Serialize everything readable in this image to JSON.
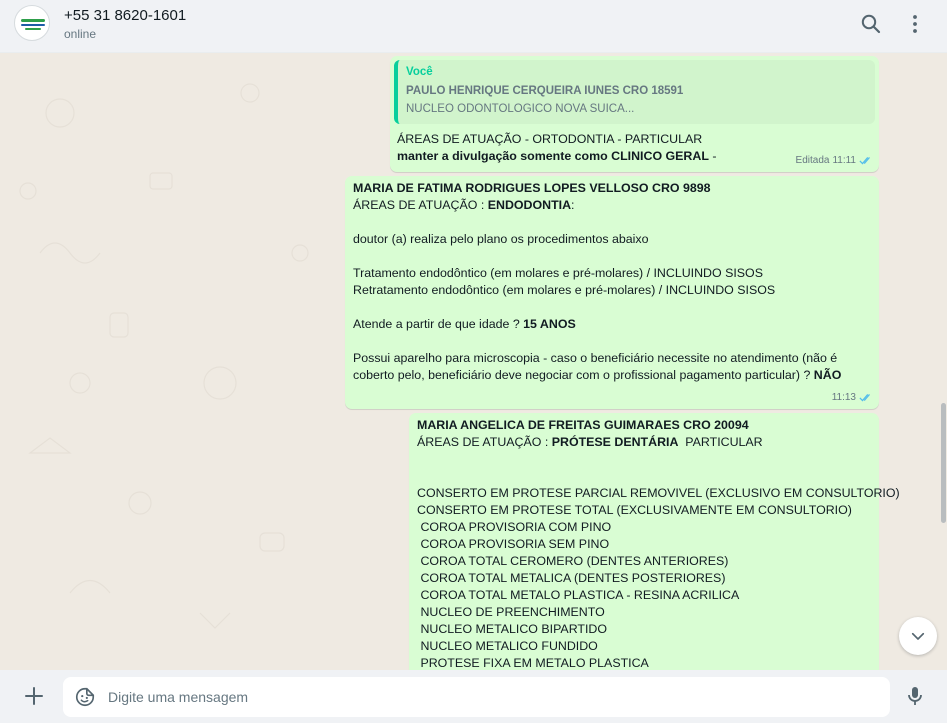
{
  "header": {
    "contact_name": "+55 31 8620-1601",
    "status": "online",
    "icons": [
      "search-icon",
      "menu-icon"
    ]
  },
  "messages": [
    {
      "quote_author": "Você",
      "quote_line1": "PAULO HENRIQUE CERQUEIRA IUNES CRO 18591",
      "quote_line2": "NUCLEO ODONTOLOGICO NOVA SUICA...",
      "line1": "ÁREAS DE ATUAÇÃO - ORTODONTIA - PARTICULAR",
      "line2_bold": "manter a divulgação somente como CLINICO GERAL",
      "line2_rest": " -",
      "meta_edited": "Editada",
      "time": "11:11"
    },
    {
      "title": "MARIA DE FATIMA RODRIGUES LOPES VELLOSO CRO 9898",
      "area_prefix": "ÁREAS DE ATUAÇÃO : ",
      "area_bold": "ENDODONTIA",
      "area_suffix": ":",
      "p1": "doutor (a) realiza pelo plano os procedimentos abaixo",
      "p2a": "Tratamento endodôntico (em molares e pré-molares) / INCLUINDO SISOS",
      "p2b": "Retratamento endodôntico (em molares e pré-molares) / INCLUINDO SISOS",
      "p3_text": "Atende a partir de que idade ? ",
      "p3_bold": "15 ANOS",
      "p4a": "Possui aparelho para microscopia - caso o beneficiário necessite no atendimento (não é",
      "p4b_text": "coberto pelo, beneficiário deve negociar com o profissional pagamento particular) ? ",
      "p4b_bold": "NÃO",
      "time": "11:13"
    },
    {
      "title": "MARIA ANGELICA DE FREITAS GUIMARAES CRO 20094",
      "area_prefix": "ÁREAS DE ATUAÇÃO : ",
      "area_bold": "PRÓTESE DENTÁRIA",
      "area_suffix": "  PARTICULAR",
      "lines": [
        "CONSERTO EM PROTESE PARCIAL REMOVIVEL (EXCLUSIVO EM CONSULTORIO)",
        "CONSERTO EM PROTESE TOTAL (EXCLUSIVAMENTE EM CONSULTORIO)",
        " COROA PROVISORIA COM PINO",
        " COROA PROVISORIA SEM PINO",
        " COROA TOTAL CEROMERO (DENTES ANTERIORES)",
        " COROA TOTAL METALICA (DENTES POSTERIORES)",
        " COROA TOTAL METALO PLASTICA - RESINA ACRILICA",
        " NUCLEO DE PREENCHIMENTO",
        " NUCLEO METALICO BIPARTIDO",
        " NUCLEO METALICO FUNDIDO",
        " PROTESE FIXA EM METALO PLASTICA"
      ]
    }
  ],
  "composer": {
    "placeholder": "Digite uma mensagem",
    "value": ""
  },
  "colors": {
    "outgoing_bubble": "#d9fdd3",
    "quote_accent": "#06cf9c",
    "read_ticks": "#53bdeb"
  }
}
